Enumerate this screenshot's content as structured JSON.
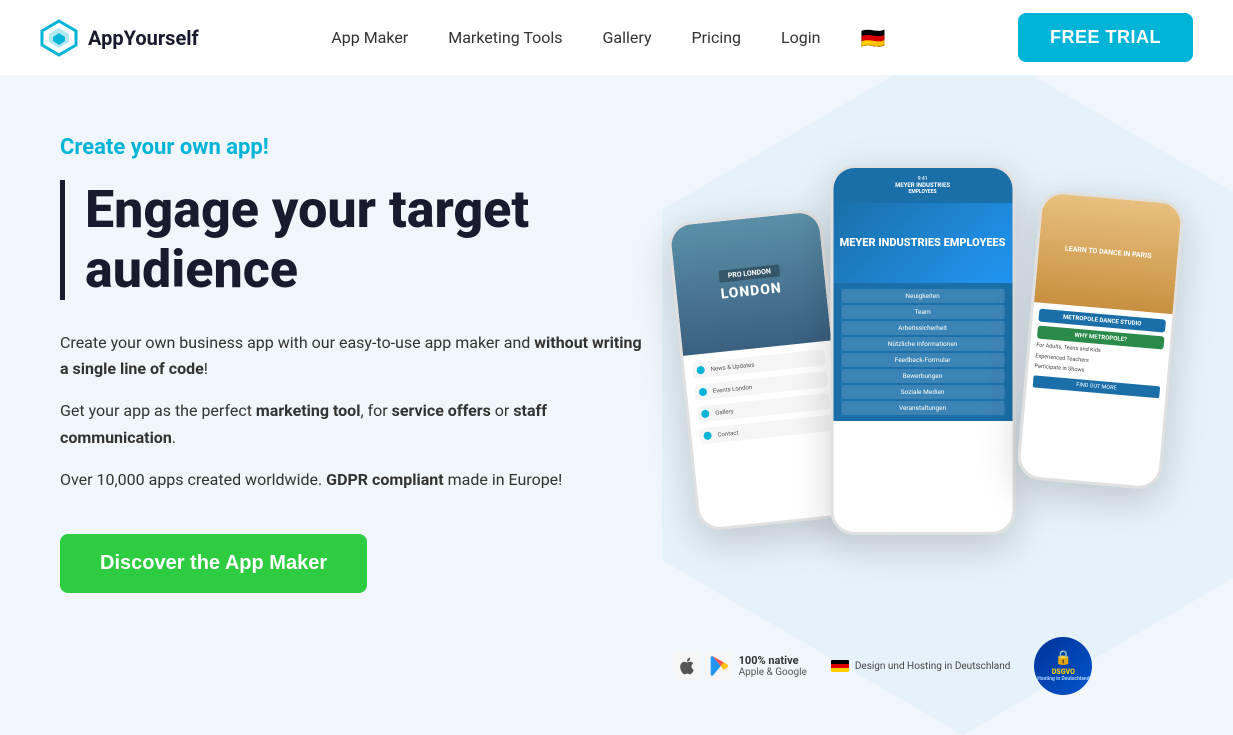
{
  "header": {
    "logo_text": "AppYourself",
    "nav": {
      "items": [
        {
          "label": "App Maker",
          "id": "app-maker"
        },
        {
          "label": "Marketing Tools",
          "id": "marketing-tools"
        },
        {
          "label": "Gallery",
          "id": "gallery"
        },
        {
          "label": "Pricing",
          "id": "pricing"
        },
        {
          "label": "Login",
          "id": "login"
        }
      ]
    },
    "free_trial_label": "FREE TRIAL"
  },
  "hero": {
    "tagline": "Create your own app!",
    "heading_line1": "Engage your target",
    "heading_line2": "audience",
    "para1": "Create your own business app with our easy-to-use app maker and ",
    "para1_bold": "without writing a single line of code",
    "para1_end": "!",
    "para2_start": "Get your app as the perfect ",
    "para2_bold1": "marketing tool",
    "para2_mid": ", for ",
    "para2_bold2": "service offers",
    "para2_mid2": " or ",
    "para2_bold3": "staff communication",
    "para2_end": ".",
    "para3_start": "Over 10,000 apps created worldwide. ",
    "para3_bold": "GDPR compliant",
    "para3_end": " made in Europe!",
    "cta_label": "Discover the App Maker"
  },
  "phones": {
    "left": {
      "city": "LONDON",
      "tag": "PRO LONDON"
    },
    "center": {
      "company": "MEYER INDUSTRIES EMPLOYEES",
      "menu_items": [
        "Neuigkeiten",
        "Team",
        "Arbeitssicherheit",
        "Nützliche Informationen",
        "Feedback-Formular",
        "Bewerbungen",
        "Soziale Medien",
        "Veranstaltungen"
      ]
    },
    "right": {
      "title": "LEARN TO DANCE IN PARIS",
      "badge": "METROPOLE DANCE STUDIO",
      "why": "WHY METROPOLE?",
      "lines": [
        "For Adults, Teens and Kids",
        "Experienced Teachers",
        "Participate in Shows"
      ]
    }
  },
  "badges": {
    "native_label": "100% native",
    "native_sub": "Apple & Google",
    "design_label": "Design und Hosting in Deutschland",
    "dsgvo_label": "DSGVO",
    "dsgvo_sub": "Hosting in Deutschland"
  }
}
